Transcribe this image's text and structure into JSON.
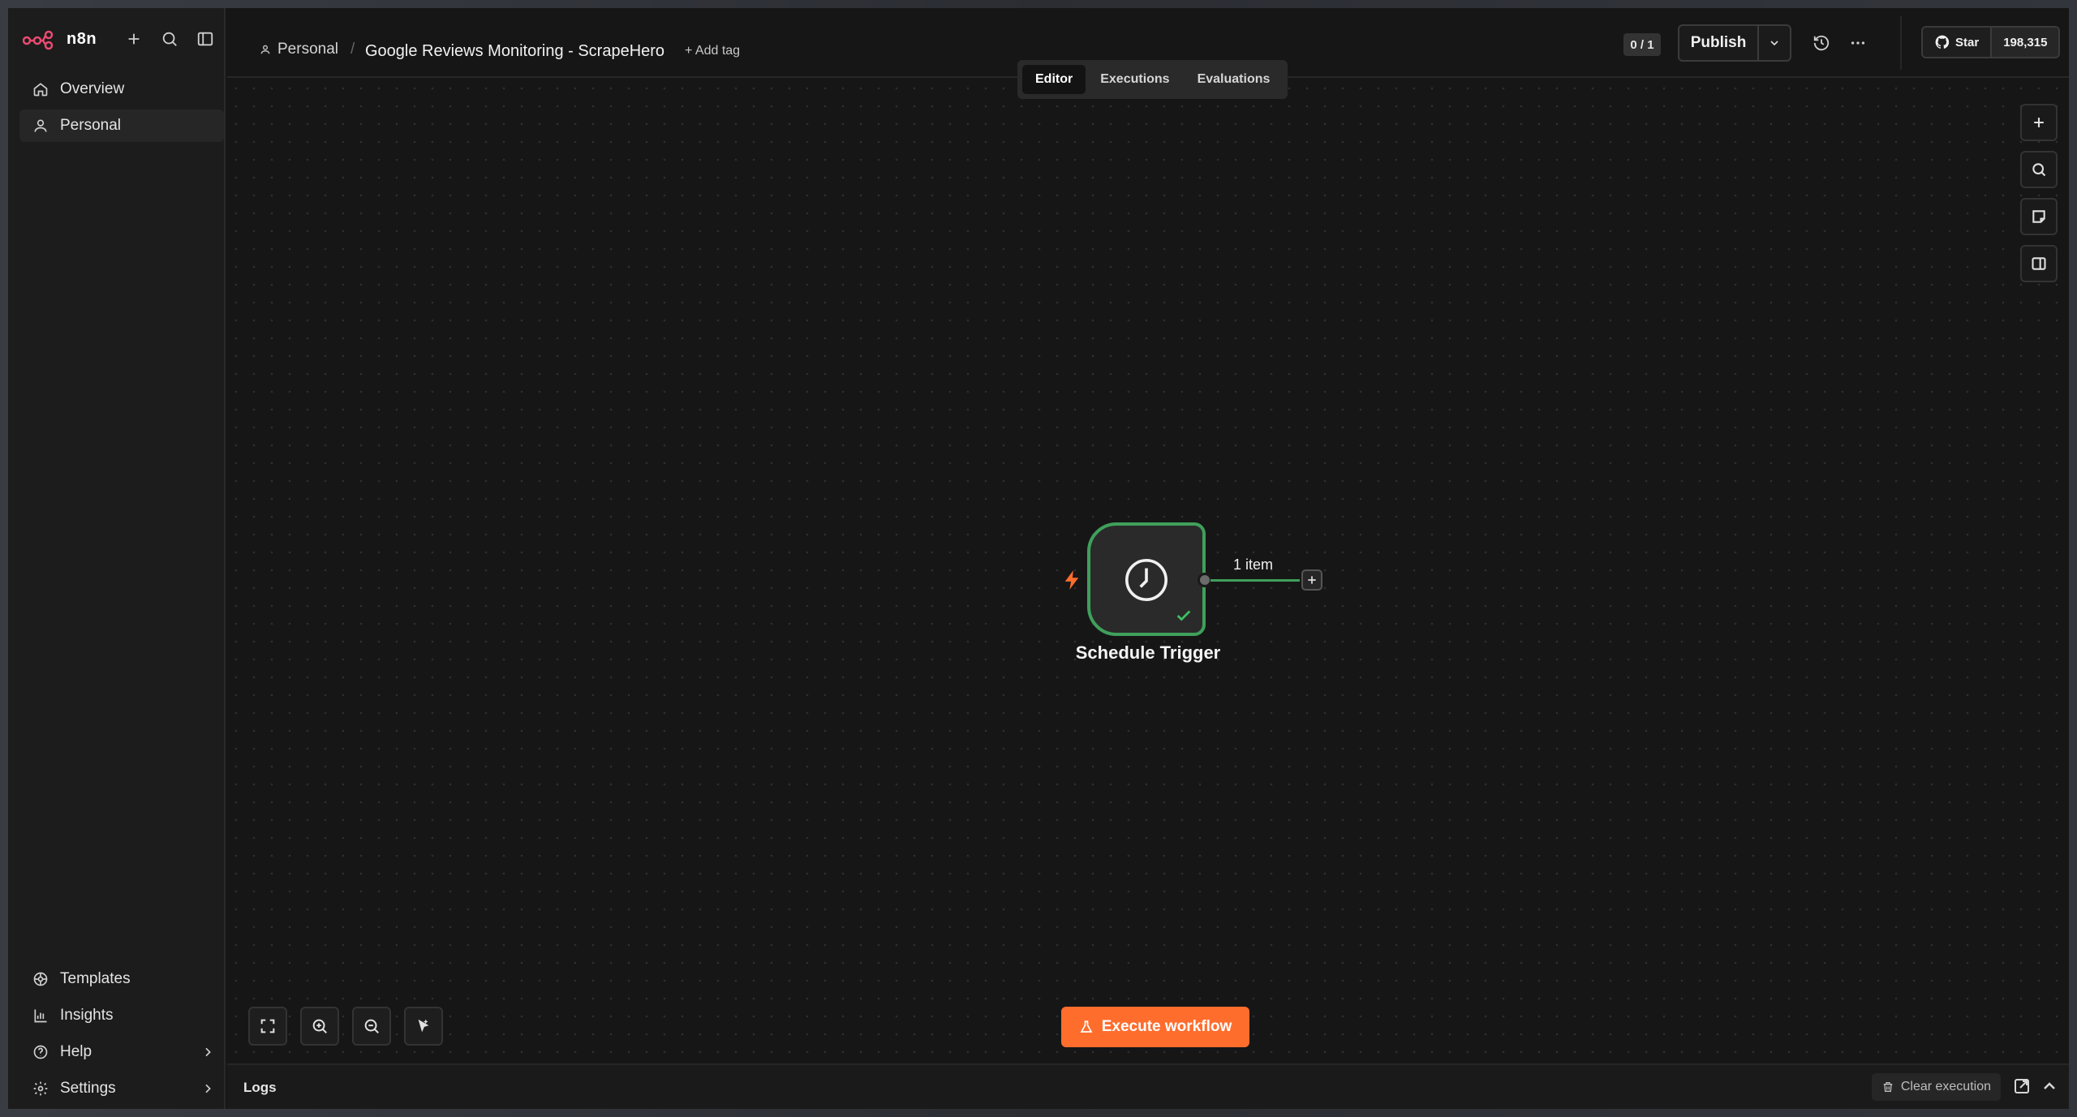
{
  "app": {
    "brand": "n8n",
    "accent": "#ff6d2d",
    "success": "#3fa05b"
  },
  "sidebar": {
    "top_items": [
      {
        "label": "Overview",
        "icon": "home-icon"
      },
      {
        "label": "Personal",
        "icon": "user-icon",
        "active": true
      }
    ],
    "bottom_items": [
      {
        "label": "Templates",
        "icon": "templates-icon"
      },
      {
        "label": "Insights",
        "icon": "bar-chart-icon"
      },
      {
        "label": "Help",
        "icon": "help-circle-icon"
      },
      {
        "label": "Settings",
        "icon": "gear-icon"
      }
    ]
  },
  "header": {
    "project": "Personal",
    "workflow_name": "Google Reviews Monitoring - ScrapeHero",
    "add_tag": "+ Add tag",
    "counter": "0 / 1",
    "publish": "Publish",
    "github_star": "Star",
    "github_count": "198,315"
  },
  "tabs": [
    {
      "label": "Editor",
      "active": true
    },
    {
      "label": "Executions"
    },
    {
      "label": "Evaluations"
    }
  ],
  "canvas": {
    "node": {
      "label": "Schedule Trigger",
      "icon": "clock-icon",
      "status": "success"
    },
    "connection_label": "1 item",
    "execute_button": "Execute workflow"
  },
  "logs": {
    "title": "Logs",
    "clear_execution": "Clear execution"
  }
}
